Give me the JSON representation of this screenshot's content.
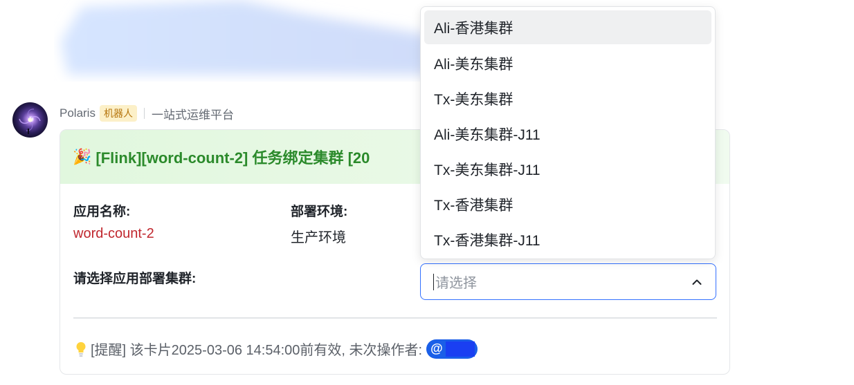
{
  "sender": {
    "name": "Polaris",
    "badge": "机器人",
    "subtitle": "一站式运维平台"
  },
  "card": {
    "title": "[Flink][word-count-2] 任务绑定集群 [20",
    "app_name_label": "应用名称:",
    "app_name_value": "word-count-2",
    "env_label": "部署环境:",
    "env_value": "生产环境",
    "cluster_label": "请选择应用部署集群:",
    "footer_text": "[提醒] 该卡片2025-03-06 14:54:00前有效, 未次操作者:",
    "mention_at": "@"
  },
  "select": {
    "placeholder": "请选择",
    "options": [
      "Ali-香港集群",
      "Ali-美东集群",
      "Tx-美东集群",
      "Ali-美东集群-J11",
      "Tx-美东集群-J11",
      "Tx-香港集群",
      "Tx-香港集群-J11"
    ]
  },
  "colors": {
    "title_green": "#2b8a2b",
    "app_name_red": "#c0262d",
    "accent_blue": "#3370ff"
  }
}
